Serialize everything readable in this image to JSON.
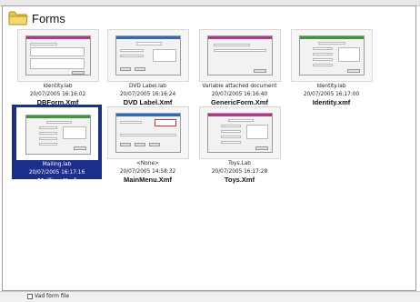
{
  "header": {
    "title": "Forms",
    "folder_icon": "folder-icon"
  },
  "files": [
    {
      "line1": "Identity.lab",
      "line2": "20/07/2005 16:16:02",
      "name": "DBForm.Xmf",
      "accent": "#b23a8a",
      "selected": false
    },
    {
      "line1": "DVD Label.lab",
      "line2": "20/07/2005 16:16:24",
      "name": "DVD Label.Xmf",
      "accent": "#2f6db0",
      "selected": false
    },
    {
      "line1": "Variable attached document",
      "line2": "20/07/2005 16:16:40",
      "name": "GenericForm.Xmf",
      "accent": "#b23a8a",
      "selected": false
    },
    {
      "line1": "Identity.lab",
      "line2": "20/07/2005 16:17:00",
      "name": "Identity.xmf",
      "accent": "#3a9a3a",
      "selected": false
    },
    {
      "line1": "Mailing.lab",
      "line2": "20/07/2005 16:17:16",
      "name": "Mailing.Xmf",
      "accent": "#3a9a3a",
      "selected": true
    },
    {
      "line1": "<None>",
      "line2": "20/07/2005 14:58:32",
      "name": "MainMenu.Xmf",
      "accent": "#2f6db0",
      "selected": false
    },
    {
      "line1": "Toys.Lab",
      "line2": "20/07/2005 16:17:28",
      "name": "Toys.Xmf",
      "accent": "#b23a8a",
      "selected": false
    }
  ],
  "status_bar": {
    "text": "Vad form file"
  }
}
